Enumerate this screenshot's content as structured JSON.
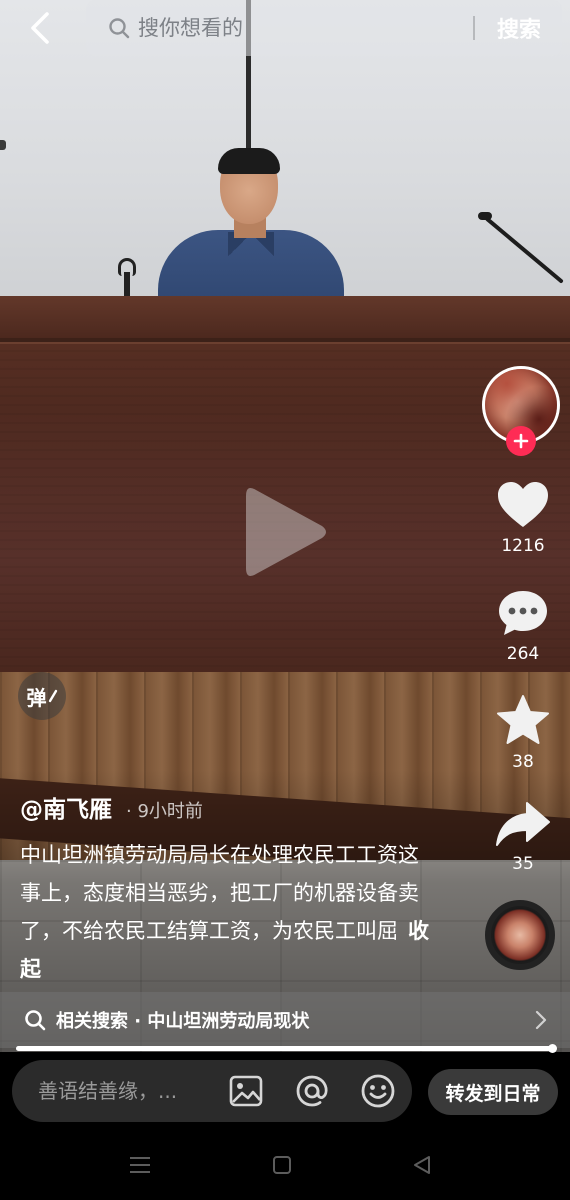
{
  "search": {
    "placeholder": "搜你想看的",
    "submit_label": "搜索"
  },
  "video": {
    "state": "paused"
  },
  "actions": {
    "likes": "1216",
    "comments": "264",
    "favorites": "38",
    "shares": "35"
  },
  "danmaku": {
    "label": "弹"
  },
  "post": {
    "author": "@南飞雁",
    "time": "· 9小时前",
    "caption": "中山坦洲镇劳动局局长在处理农民工工资这事上，态度相当恶劣，把工厂的机器设备卖了，不给农民工结算工资，为农民工叫屈",
    "collapse_label": "收起"
  },
  "related_search": {
    "text": "相关搜索 · 中山坦洲劳动局现状"
  },
  "progress": {
    "fraction": 0.995
  },
  "comment_bar": {
    "placeholder": "善语结善缘，...",
    "share_daily_label": "转发到日常"
  },
  "colors": {
    "accent": "#fe2c55",
    "background": "#000000"
  }
}
